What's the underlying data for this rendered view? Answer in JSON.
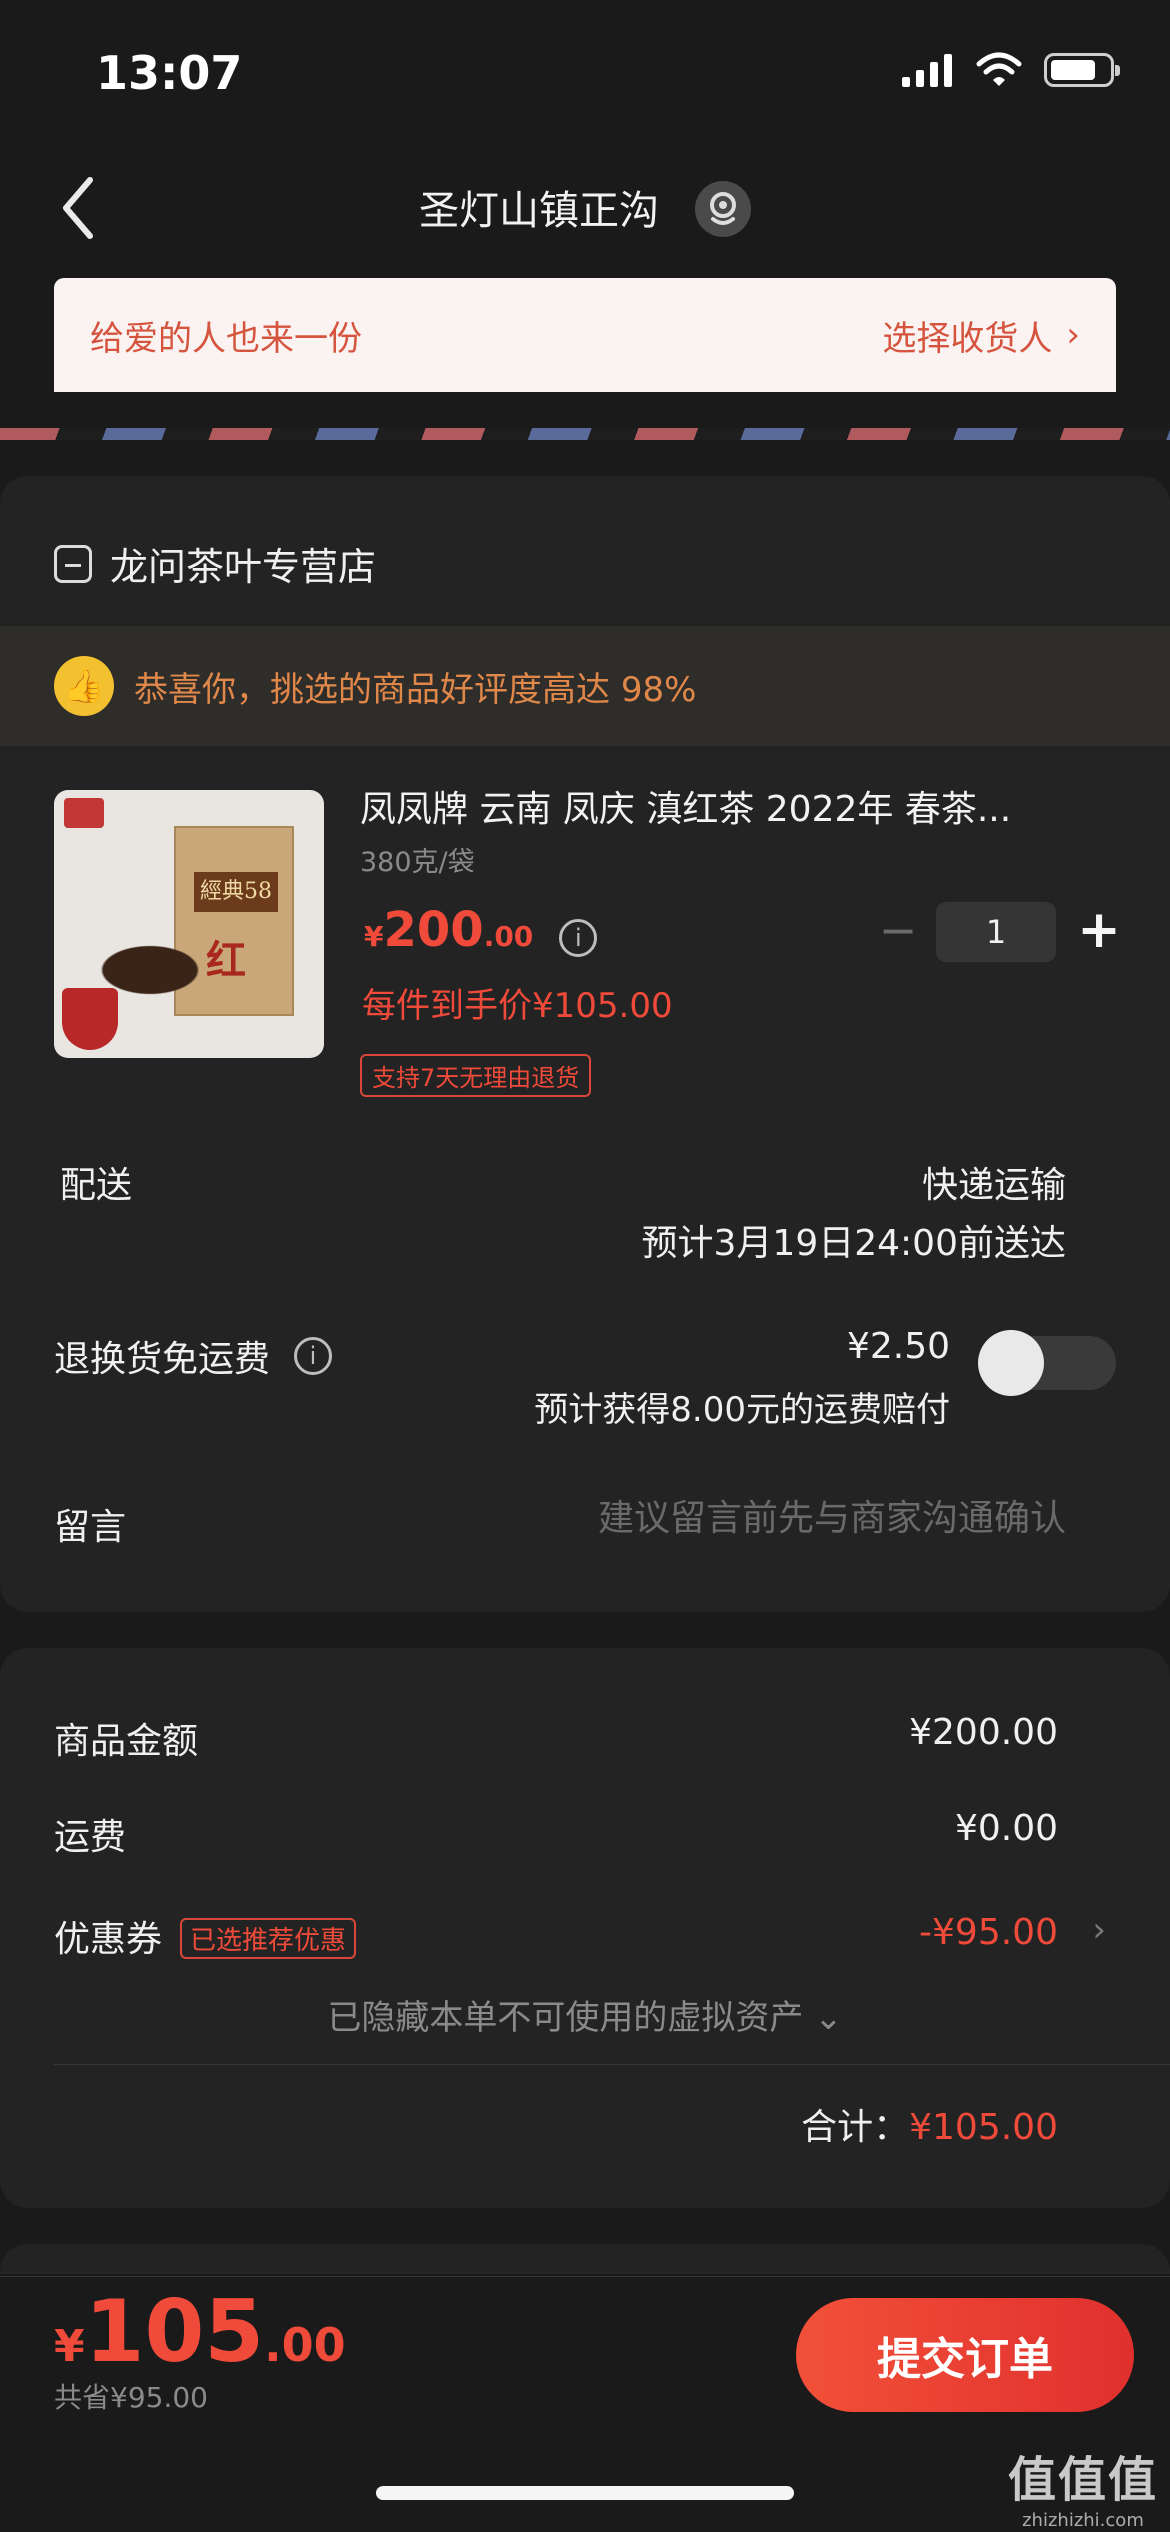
{
  "status_bar": {
    "time": "13:07"
  },
  "header": {
    "title": "圣灯山镇正沟"
  },
  "gift_banner": {
    "left_text": "给爱的人也来一份",
    "right_text": "选择收货人",
    "chevron": "›"
  },
  "shop": {
    "name": "龙问茶叶专营店"
  },
  "praise": {
    "text": "恭喜你，挑选的商品好评度高达",
    "rate": "98%"
  },
  "product": {
    "title": "凤凤牌 云南 凤庆 滇红茶 2022年 春茶...",
    "spec": "380克/袋",
    "price_yen": "¥",
    "price_int": "200",
    "price_dec": ".00",
    "info_glyph": "i",
    "deal_price": "每件到手价¥105.00",
    "return_tag": "支持7天无理由退货",
    "quantity": "1",
    "qty_minus": "−",
    "qty_plus": "+",
    "img_label": "經典58",
    "img_red_text": "红"
  },
  "delivery": {
    "label": "配送",
    "method": "快递运输",
    "eta": "预计3月19日24:00前送达"
  },
  "insurance": {
    "label": "退换货免运费",
    "price": "¥2.50",
    "desc": "预计获得8.00元的运费赔付",
    "enabled": false
  },
  "message": {
    "label": "留言",
    "placeholder": "建议留言前先与商家沟通确认"
  },
  "summary": {
    "goods_label": "商品金额",
    "goods_value": "¥200.00",
    "shipping_label": "运费",
    "shipping_value": "¥0.00",
    "coupon_label": "优惠券",
    "coupon_tag": "已选推荐优惠",
    "coupon_value": "-¥95.00",
    "coupon_chevron": "›",
    "hidden_assets": "已隐藏本单不可使用的虚拟资产",
    "hidden_chevron": "⌄",
    "total_label": "合计：",
    "total_value": "¥105.00"
  },
  "bottom_bar": {
    "pay_yen": "¥",
    "pay_int": "105",
    "pay_dec": ".00",
    "saved": "共省¥95.00",
    "submit_label": "提交订单"
  },
  "watermark": {
    "main": "值值值",
    "sub": "zhizhizhi.com"
  },
  "colors": {
    "accent": "#f04a3a",
    "background": "#1a1a1a",
    "card": "#232323",
    "praise_text": "#e0874a"
  }
}
